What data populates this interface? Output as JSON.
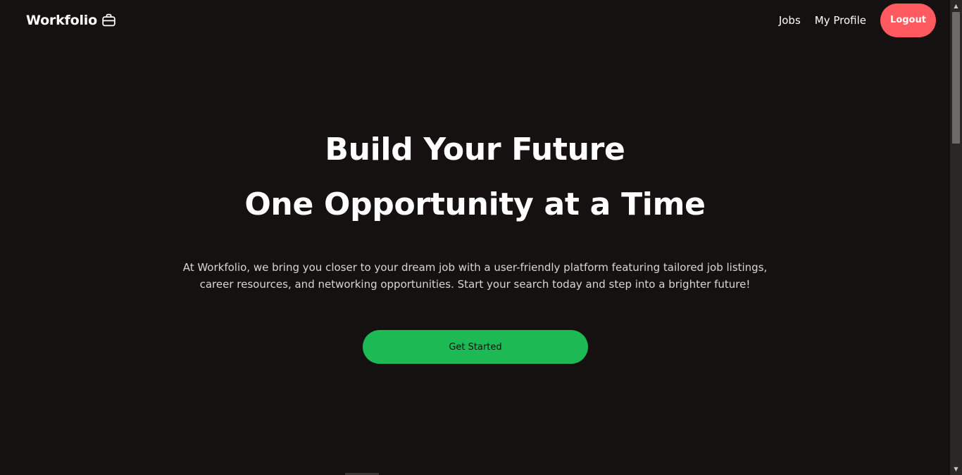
{
  "navbar": {
    "brand": "Workfolio",
    "brand_icon": "briefcase-icon",
    "links": {
      "jobs": "Jobs",
      "profile": "My Profile"
    },
    "logout_label": "Logout"
  },
  "hero": {
    "title_line1": "Build Your Future",
    "title_line2": "One Opportunity at a Time",
    "description": "At Workfolio, we bring you closer to your dream job with a user-friendly platform featuring tailored job listings, career resources, and networking opportunities. Start your search today and step into a brighter future!",
    "cta_label": "Get Started"
  },
  "colors": {
    "background": "#151111",
    "logout": "#ff5a60",
    "cta": "#1db954"
  }
}
